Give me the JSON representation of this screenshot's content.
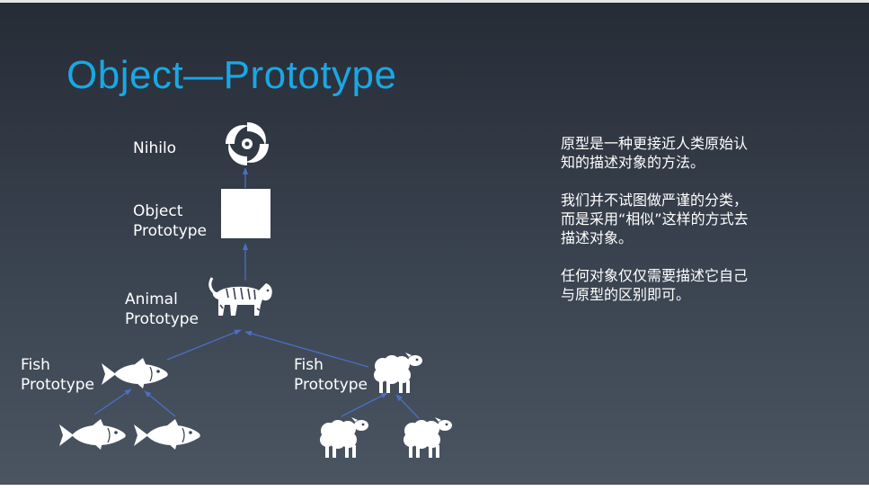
{
  "slide": {
    "title": "Object—Prototype",
    "nodes": {
      "nihilo": "Nihilo",
      "object_prototype": [
        "Object",
        "Prototype"
      ],
      "animal_prototype": [
        "Animal",
        "Prototype"
      ],
      "fish_prototype": [
        "Fish",
        "Prototype"
      ],
      "sheep_prototype": [
        "Fish",
        "Prototype"
      ]
    },
    "notes": [
      "原型是一种更接近人类原始认知的描述对象的方法。",
      "我们并不试图做严谨的分类，而是采用“相似”这样的方式去描述对象。",
      "任何对象仅仅需要描述它自己与原型的区别即可。"
    ]
  },
  "icons": {
    "nihilo": "spiral-icon",
    "object": "white-square",
    "animal": "tiger-icon",
    "fish": "fish-icon",
    "sheep": "sheep-icon"
  },
  "colors": {
    "title": "#1aa7e4",
    "arrow": "#4a6fc4",
    "text": "#ffffff"
  }
}
